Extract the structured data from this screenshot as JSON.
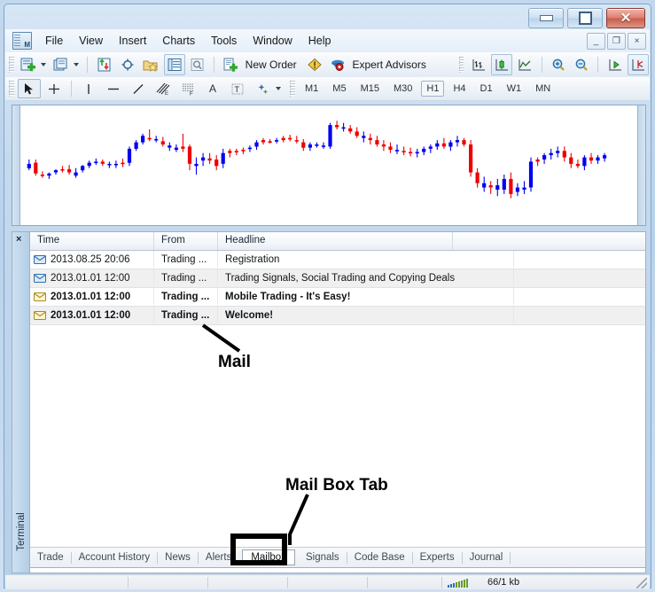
{
  "window": {
    "controls": {
      "minimize": "minimize-button",
      "maximize": "maximize-button",
      "close": "close-button"
    },
    "mdi_controls": {
      "minimize": "_",
      "restore": "❐",
      "close": "×"
    }
  },
  "menu": {
    "items": [
      "File",
      "View",
      "Insert",
      "Charts",
      "Tools",
      "Window",
      "Help"
    ]
  },
  "toolbar_main": {
    "buttons": [
      {
        "name": "new-chart-icon",
        "label": ""
      },
      {
        "name": "new-chart-dropdown-icon",
        "label": ""
      },
      {
        "name": "profiles-icon",
        "label": ""
      },
      {
        "name": "profiles-dropdown-icon",
        "label": ""
      },
      {
        "name": "market-watch-icon",
        "label": ""
      },
      {
        "name": "data-window-icon",
        "label": ""
      },
      {
        "name": "navigator-icon",
        "label": ""
      },
      {
        "name": "terminal-icon",
        "label": ""
      },
      {
        "name": "strategy-tester-icon",
        "label": ""
      }
    ],
    "new_order_label": "New Order",
    "expert_advisors_label": "Expert Advisors",
    "chart_tools": [
      {
        "name": "bar-chart-icon"
      },
      {
        "name": "candlestick-chart-icon"
      },
      {
        "name": "line-chart-icon"
      },
      {
        "name": "zoom-in-icon"
      },
      {
        "name": "zoom-out-icon"
      },
      {
        "name": "auto-scroll-icon"
      },
      {
        "name": "chart-shift-icon"
      }
    ]
  },
  "toolbar_draw": {
    "tools": [
      {
        "name": "cursor-tool",
        "glyph": "➤"
      },
      {
        "name": "crosshair-tool",
        "glyph": "+"
      },
      {
        "name": "vertical-line-tool",
        "glyph": "|"
      },
      {
        "name": "horizontal-line-tool",
        "glyph": "—"
      },
      {
        "name": "trendline-tool",
        "glyph": "╱"
      },
      {
        "name": "equidistant-channel-tool",
        "glyph": "E"
      },
      {
        "name": "fibonacci-tool",
        "glyph": "F"
      },
      {
        "name": "text-tool",
        "glyph": "A"
      },
      {
        "name": "text-label-tool",
        "glyph": "T"
      },
      {
        "name": "objects-tool",
        "glyph": "✦"
      }
    ],
    "timeframes": [
      "M1",
      "M5",
      "M15",
      "M30",
      "H1",
      "H4",
      "D1",
      "W1",
      "MN"
    ],
    "selected_timeframe": "H1"
  },
  "chart_data": {
    "type": "candlestick",
    "title": "",
    "up_color": "#0000ee",
    "down_color": "#ee0000",
    "candles": [
      {
        "o": 42,
        "h": 46,
        "l": 36,
        "c": 38,
        "d": "up"
      },
      {
        "o": 43,
        "h": 46,
        "l": 31,
        "c": 33,
        "d": "down"
      },
      {
        "o": 32,
        "h": 35,
        "l": 29,
        "c": 31,
        "d": "down"
      },
      {
        "o": 31,
        "h": 34,
        "l": 28,
        "c": 33,
        "d": "up"
      },
      {
        "o": 34,
        "h": 37,
        "l": 32,
        "c": 36,
        "d": "up"
      },
      {
        "o": 36,
        "h": 40,
        "l": 34,
        "c": 37,
        "d": "down"
      },
      {
        "o": 37,
        "h": 41,
        "l": 32,
        "c": 34,
        "d": "down"
      },
      {
        "o": 34,
        "h": 38,
        "l": 29,
        "c": 31,
        "d": "up"
      },
      {
        "o": 36,
        "h": 41,
        "l": 34,
        "c": 40,
        "d": "up"
      },
      {
        "o": 40,
        "h": 45,
        "l": 38,
        "c": 43,
        "d": "up"
      },
      {
        "o": 43,
        "h": 47,
        "l": 41,
        "c": 44,
        "d": "up"
      },
      {
        "o": 44,
        "h": 46,
        "l": 40,
        "c": 42,
        "d": "down"
      },
      {
        "o": 42,
        "h": 44,
        "l": 38,
        "c": 41,
        "d": "up"
      },
      {
        "o": 41,
        "h": 45,
        "l": 38,
        "c": 42,
        "d": "up"
      },
      {
        "o": 42,
        "h": 47,
        "l": 39,
        "c": 43,
        "d": "down"
      },
      {
        "o": 43,
        "h": 58,
        "l": 40,
        "c": 56,
        "d": "up"
      },
      {
        "o": 56,
        "h": 64,
        "l": 54,
        "c": 62,
        "d": "up"
      },
      {
        "o": 62,
        "h": 70,
        "l": 60,
        "c": 68,
        "d": "up"
      },
      {
        "o": 66,
        "h": 74,
        "l": 63,
        "c": 65,
        "d": "down"
      },
      {
        "o": 65,
        "h": 68,
        "l": 62,
        "c": 64,
        "d": "up"
      },
      {
        "o": 63,
        "h": 67,
        "l": 58,
        "c": 60,
        "d": "down"
      },
      {
        "o": 59,
        "h": 62,
        "l": 54,
        "c": 57,
        "d": "up"
      },
      {
        "o": 57,
        "h": 60,
        "l": 53,
        "c": 55,
        "d": "up"
      },
      {
        "o": 56,
        "h": 70,
        "l": 53,
        "c": 58,
        "d": "down"
      },
      {
        "o": 58,
        "h": 60,
        "l": 36,
        "c": 42,
        "d": "down"
      },
      {
        "o": 42,
        "h": 48,
        "l": 32,
        "c": 40,
        "d": "up"
      },
      {
        "o": 45,
        "h": 52,
        "l": 40,
        "c": 48,
        "d": "up"
      },
      {
        "o": 47,
        "h": 52,
        "l": 42,
        "c": 45,
        "d": "down"
      },
      {
        "o": 46,
        "h": 50,
        "l": 36,
        "c": 40,
        "d": "down"
      },
      {
        "o": 42,
        "h": 56,
        "l": 38,
        "c": 52,
        "d": "up"
      },
      {
        "o": 52,
        "h": 56,
        "l": 48,
        "c": 54,
        "d": "down"
      },
      {
        "o": 53,
        "h": 56,
        "l": 50,
        "c": 54,
        "d": "down"
      },
      {
        "o": 54,
        "h": 57,
        "l": 51,
        "c": 55,
        "d": "down"
      },
      {
        "o": 56,
        "h": 59,
        "l": 53,
        "c": 57,
        "d": "up"
      },
      {
        "o": 58,
        "h": 64,
        "l": 55,
        "c": 62,
        "d": "up"
      },
      {
        "o": 62,
        "h": 66,
        "l": 60,
        "c": 64,
        "d": "down"
      },
      {
        "o": 63,
        "h": 65,
        "l": 61,
        "c": 63,
        "d": "down"
      },
      {
        "o": 63,
        "h": 66,
        "l": 61,
        "c": 64,
        "d": "up"
      },
      {
        "o": 64,
        "h": 68,
        "l": 62,
        "c": 66,
        "d": "down"
      },
      {
        "o": 66,
        "h": 69,
        "l": 63,
        "c": 65,
        "d": "down"
      },
      {
        "o": 64,
        "h": 68,
        "l": 61,
        "c": 63,
        "d": "down"
      },
      {
        "o": 62,
        "h": 65,
        "l": 54,
        "c": 57,
        "d": "down"
      },
      {
        "o": 57,
        "h": 62,
        "l": 54,
        "c": 60,
        "d": "up"
      },
      {
        "o": 60,
        "h": 62,
        "l": 57,
        "c": 59,
        "d": "up"
      },
      {
        "o": 59,
        "h": 62,
        "l": 56,
        "c": 58,
        "d": "up"
      },
      {
        "o": 58,
        "h": 80,
        "l": 56,
        "c": 78,
        "d": "up"
      },
      {
        "o": 78,
        "h": 82,
        "l": 74,
        "c": 76,
        "d": "down"
      },
      {
        "o": 76,
        "h": 80,
        "l": 72,
        "c": 75,
        "d": "up"
      },
      {
        "o": 75,
        "h": 78,
        "l": 70,
        "c": 72,
        "d": "down"
      },
      {
        "o": 72,
        "h": 76,
        "l": 66,
        "c": 68,
        "d": "down"
      },
      {
        "o": 68,
        "h": 72,
        "l": 62,
        "c": 66,
        "d": "up"
      },
      {
        "o": 66,
        "h": 70,
        "l": 60,
        "c": 64,
        "d": "down"
      },
      {
        "o": 64,
        "h": 68,
        "l": 58,
        "c": 60,
        "d": "down"
      },
      {
        "o": 60,
        "h": 64,
        "l": 54,
        "c": 58,
        "d": "down"
      },
      {
        "o": 58,
        "h": 62,
        "l": 52,
        "c": 55,
        "d": "down"
      },
      {
        "o": 55,
        "h": 60,
        "l": 51,
        "c": 54,
        "d": "up"
      },
      {
        "o": 54,
        "h": 58,
        "l": 50,
        "c": 53,
        "d": "down"
      },
      {
        "o": 53,
        "h": 57,
        "l": 49,
        "c": 52,
        "d": "down"
      },
      {
        "o": 52,
        "h": 56,
        "l": 48,
        "c": 53,
        "d": "up"
      },
      {
        "o": 53,
        "h": 58,
        "l": 50,
        "c": 56,
        "d": "up"
      },
      {
        "o": 56,
        "h": 60,
        "l": 52,
        "c": 58,
        "d": "up"
      },
      {
        "o": 58,
        "h": 64,
        "l": 55,
        "c": 61,
        "d": "up"
      },
      {
        "o": 61,
        "h": 66,
        "l": 56,
        "c": 58,
        "d": "down"
      },
      {
        "o": 58,
        "h": 64,
        "l": 54,
        "c": 62,
        "d": "up"
      },
      {
        "o": 62,
        "h": 68,
        "l": 58,
        "c": 64,
        "d": "up"
      },
      {
        "o": 64,
        "h": 66,
        "l": 58,
        "c": 60,
        "d": "down"
      },
      {
        "o": 60,
        "h": 64,
        "l": 30,
        "c": 34,
        "d": "down"
      },
      {
        "o": 34,
        "h": 38,
        "l": 20,
        "c": 24,
        "d": "down"
      },
      {
        "o": 24,
        "h": 30,
        "l": 16,
        "c": 20,
        "d": "up"
      },
      {
        "o": 20,
        "h": 26,
        "l": 14,
        "c": 22,
        "d": "down"
      },
      {
        "o": 22,
        "h": 28,
        "l": 12,
        "c": 18,
        "d": "up"
      },
      {
        "o": 18,
        "h": 32,
        "l": 14,
        "c": 28,
        "d": "up"
      },
      {
        "o": 28,
        "h": 34,
        "l": 10,
        "c": 14,
        "d": "down"
      },
      {
        "o": 16,
        "h": 24,
        "l": 12,
        "c": 20,
        "d": "up"
      },
      {
        "o": 20,
        "h": 26,
        "l": 14,
        "c": 18,
        "d": "up"
      },
      {
        "o": 20,
        "h": 48,
        "l": 16,
        "c": 44,
        "d": "up"
      },
      {
        "o": 44,
        "h": 48,
        "l": 40,
        "c": 46,
        "d": "down"
      },
      {
        "o": 46,
        "h": 52,
        "l": 42,
        "c": 50,
        "d": "up"
      },
      {
        "o": 50,
        "h": 56,
        "l": 46,
        "c": 52,
        "d": "up"
      },
      {
        "o": 52,
        "h": 58,
        "l": 48,
        "c": 54,
        "d": "up"
      },
      {
        "o": 54,
        "h": 58,
        "l": 44,
        "c": 48,
        "d": "down"
      },
      {
        "o": 48,
        "h": 52,
        "l": 38,
        "c": 42,
        "d": "down"
      },
      {
        "o": 42,
        "h": 46,
        "l": 38,
        "c": 40,
        "d": "down"
      },
      {
        "o": 40,
        "h": 50,
        "l": 36,
        "c": 48,
        "d": "up"
      },
      {
        "o": 48,
        "h": 52,
        "l": 42,
        "c": 45,
        "d": "down"
      },
      {
        "o": 45,
        "h": 50,
        "l": 42,
        "c": 48,
        "d": "up"
      },
      {
        "o": 47,
        "h": 52,
        "l": 44,
        "c": 50,
        "d": "up"
      }
    ]
  },
  "terminal": {
    "side_label": "Terminal",
    "close_icon": "×",
    "columns": [
      "Time",
      "From",
      "Headline"
    ],
    "rows": [
      {
        "time": "2013.08.25 20:06",
        "from": "Trading ...",
        "headline": "Registration",
        "state": "read"
      },
      {
        "time": "2013.01.01 12:00",
        "from": "Trading ...",
        "headline": "Trading Signals, Social Trading and Copying Deals",
        "state": "read"
      },
      {
        "time": "2013.01.01 12:00",
        "from": "Trading ...",
        "headline": "Mobile Trading - It's Easy!",
        "state": "unread"
      },
      {
        "time": "2013.01.01 12:00",
        "from": "Trading ...",
        "headline": "Welcome!",
        "state": "unread"
      }
    ],
    "tabs": [
      "Trade",
      "Account History",
      "News",
      "Alerts",
      "Mailbox",
      "Signals",
      "Code Base",
      "Experts",
      "Journal"
    ],
    "active_tab": "Mailbox"
  },
  "statusbar": {
    "traffic": "66/1 kb",
    "signal_icon": "network-signal-icon"
  },
  "annotations": [
    {
      "id": "mail",
      "text": "Mail"
    },
    {
      "id": "tab",
      "text": "Mail Box Tab"
    }
  ]
}
